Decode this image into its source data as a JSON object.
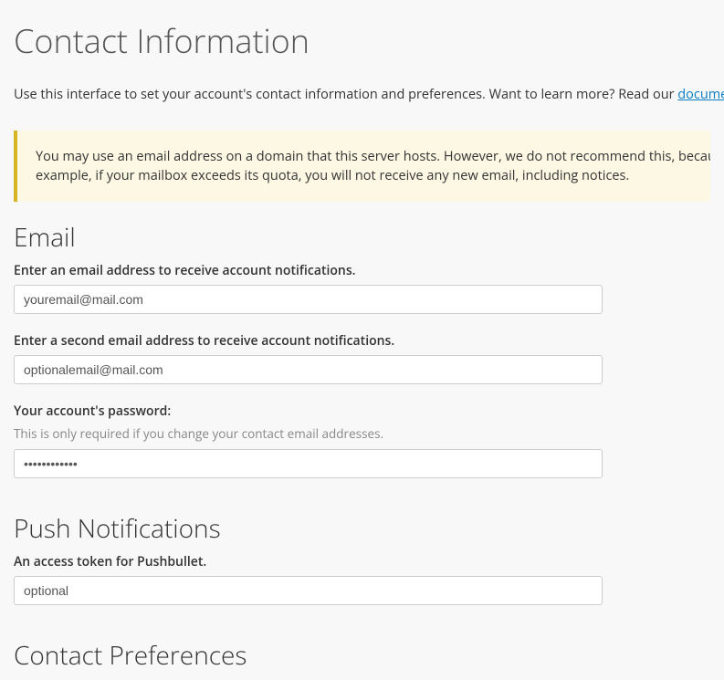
{
  "page": {
    "title": "Contact Information",
    "intro_text": "Use this interface to set your account's contact information and preferences. Want to learn more? Read our ",
    "intro_link": "documentat"
  },
  "alert": {
    "line1": "You may use an email address on a domain that this server hosts. However, we do not recommend this, because yo",
    "line2": "example, if your mailbox exceeds its quota, you will not receive any new email, including notices."
  },
  "email": {
    "heading": "Email",
    "primary_label": "Enter an email address to receive account notifications.",
    "primary_value": "youremail@mail.com",
    "secondary_label": "Enter a second email address to receive account notifications.",
    "secondary_value": "optionalemail@mail.com",
    "password_label": "Your account's password:",
    "password_hint": "This is only required if you change your contact email addresses.",
    "password_value": "••••••••••••"
  },
  "push": {
    "heading": "Push Notifications",
    "token_label": "An access token for Pushbullet.",
    "token_value": "optional"
  },
  "preferences": {
    "heading": "Contact Preferences"
  }
}
